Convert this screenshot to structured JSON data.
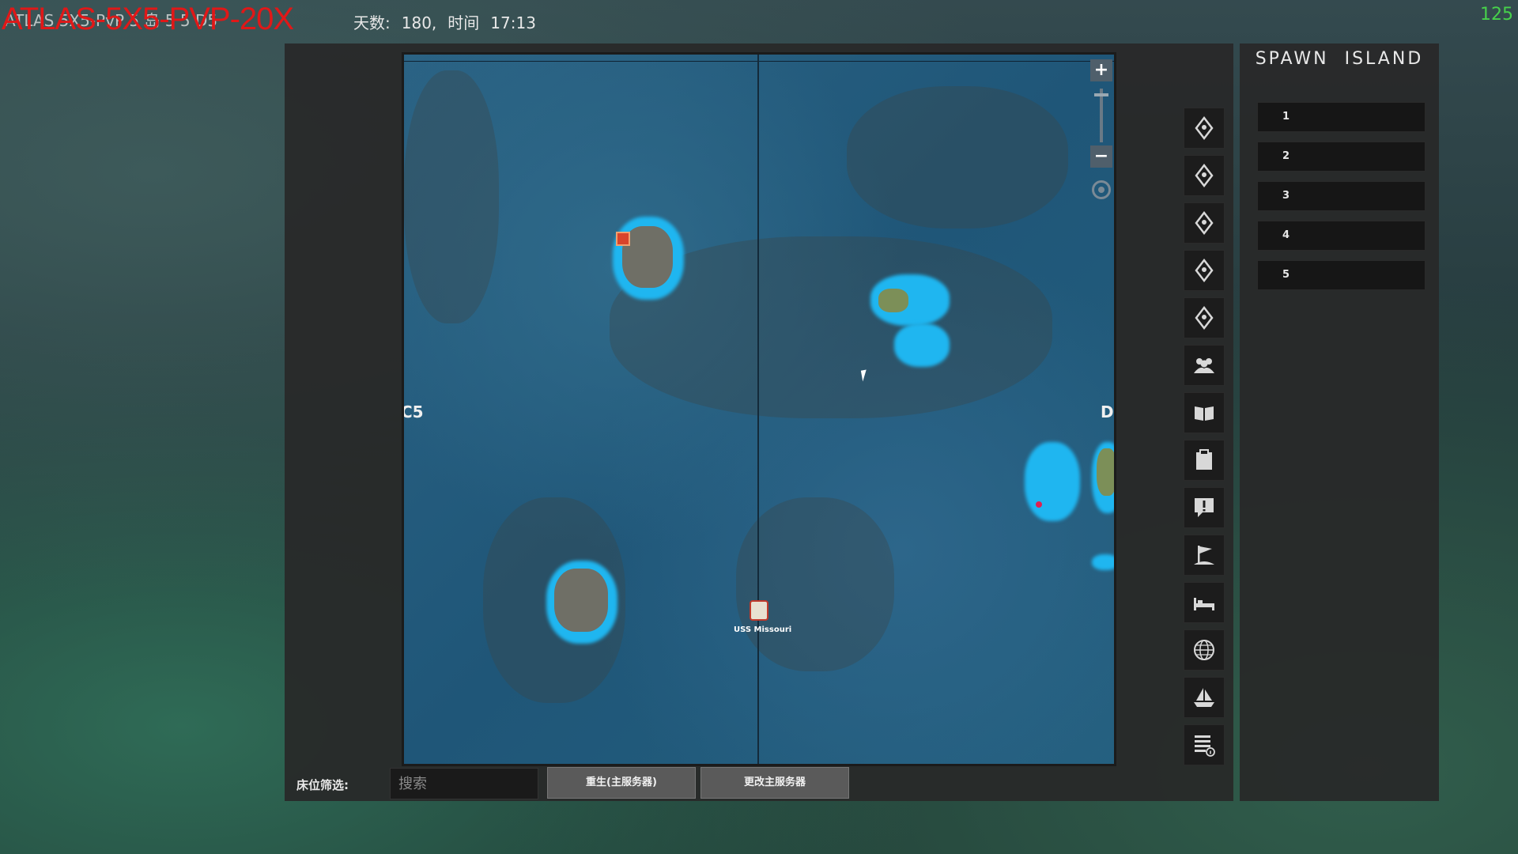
{
  "hud": {
    "server_name": "ATLAS-5X5-PVP-20X",
    "server_name_behind": "ATLAS 5X5-PvP 5 岛 5 5 D5",
    "day_label": "天数:",
    "day_value": "180,",
    "time_label": "时间",
    "time_value": "17:13",
    "fps": "125"
  },
  "map": {
    "grid_left": "C5",
    "grid_right": "D.",
    "ship_label": "USS  Missouri",
    "zoom_in": "+",
    "zoom_out": "−"
  },
  "toolbar": {
    "icons": [
      "pin-icon",
      "pin-icon",
      "pin-icon",
      "pin-icon",
      "pin-icon",
      "company-icon",
      "journal-icon",
      "clipboard-icon",
      "alert-icon",
      "flag-icon",
      "bed-icon",
      "globe-icon",
      "ship-icon",
      "log-icon"
    ]
  },
  "spawn": {
    "title": "SPAWN  ISLAND",
    "items": [
      "1",
      "2",
      "3",
      "4",
      "5"
    ]
  },
  "bottom": {
    "filter_label": "床位筛选:",
    "search_placeholder": "搜索",
    "respawn_button": "重生(主服务器)",
    "change_server_button": "更改主服务器"
  },
  "colors": {
    "server_name": "#e01818",
    "fps": "#47d14b",
    "ocean": "#1f5678",
    "island_halo": "#1fb6f0"
  }
}
